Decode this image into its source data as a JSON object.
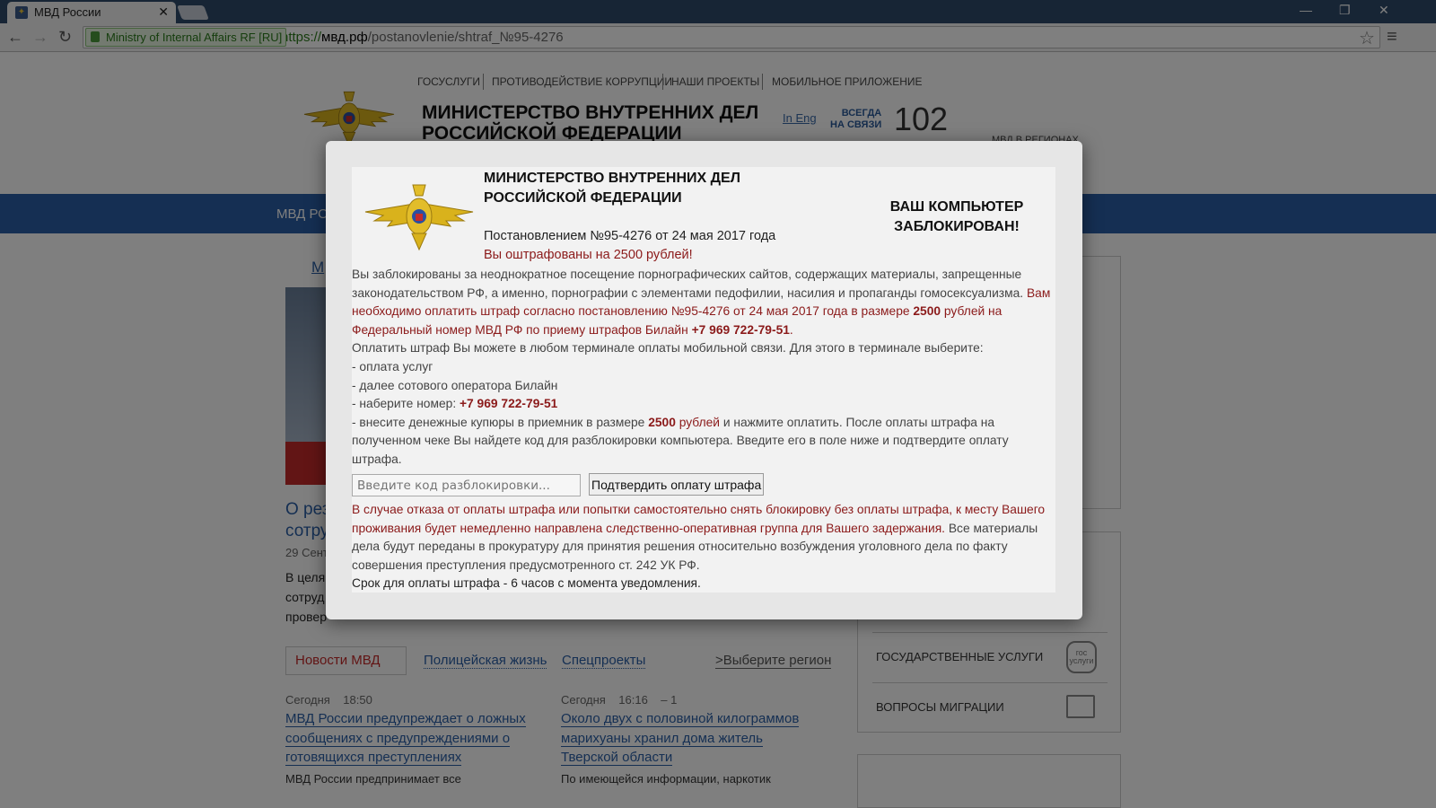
{
  "browser": {
    "tab_title": "МВД России",
    "ev_label": "Ministry of Internal Affairs RF [RU]",
    "url_proto": "https://",
    "url_host": "мвд.рф",
    "url_path": "/postanovlenie/shtraf_№95-4276"
  },
  "site": {
    "top_nav": [
      "Госуслуги",
      "Противодействие коррупции",
      "Наши проекты",
      "Мобильное приложение"
    ],
    "title_line1": "МИНИСТЕРСТВО ВНУТРЕННИХ ДЕЛ",
    "title_line2": "РОССИЙСКОЙ ФЕДЕРАЦИИ",
    "in_eng": "In Eng",
    "always_1": "ВСЕГДА",
    "always_2": "НА СВЯЗИ",
    "phone": "102",
    "regions": "МВД В РЕГИОНАХ",
    "nav_first": "МВД РО",
    "breadcrumb_frag": "М",
    "headline_frag1": "О рез",
    "headline_frag2": "сотру",
    "date_frag": "29 Сент",
    "lead_frags": [
      "В целя",
      "сотруд",
      "провер"
    ],
    "right_items": [
      "ГОСУДАРСТВЕННЫЕ УСЛУГИ",
      "ВОПРОСЫ МИГРАЦИИ"
    ],
    "gos_icon_text": "гос услуги",
    "tabs": [
      "Новости МВД",
      "Полицейская жизнь",
      "Спецпроекты"
    ],
    "region_link": ">Выберите регион",
    "news": [
      {
        "day": "Сегодня",
        "time": "18:50",
        "extra": "",
        "title": [
          "МВД России предупреждает о ложных",
          "сообщениях с предупреждениями о",
          "готовящихся преступлениях"
        ],
        "lead": "МВД России предпринимает все"
      },
      {
        "day": "Сегодня",
        "time": "16:16",
        "extra": "– 1",
        "title": [
          "Около двух с половиной килограммов",
          "марихуаны хранил дома житель",
          "Тверской области"
        ],
        "lead": "По имеющейся информации, наркотик"
      }
    ]
  },
  "dialog": {
    "title_line1": "МИНИСТЕРСТВО ВНУТРЕННИХ ДЕЛ",
    "title_line2": "РОССИЙСКОЙ ФЕДЕРАЦИИ",
    "blocked_line1": "ВАШ КОМПЬЮТЕР",
    "blocked_line2": "ЗАБЛОКИРОВАН!",
    "decree": "Постановлением №95-4276 от 24 мая 2017 года",
    "fined": "Вы оштрафованы на 2500 рублей!",
    "p1_gray": "Вы заблокированы за неоднократное посещение порнографических сайтов, содержащих материалы, запрещенные законодательством РФ, а именно, порнографии с элементами педофилии, насилия и пропаганды гомосексуализма. ",
    "p1_red": "Вам необходимо оплатить штраф согласно постановлению №95-4276 от 24 мая 2017 года в размере ",
    "amount": "2500",
    "p1_red2": " рублей на Федеральный номер МВД РФ по приему штрафов Билайн ",
    "pay_phone": "+7 969 722-79-51",
    "dot": ".",
    "p2": "Оплатить штраф Вы можете в любом терминале оплаты мобильной связи. Для этого в терминале выберите:",
    "step1": "- оплата услуг",
    "step2": "- далее сотового оператора Билайн",
    "step3": "- наберите номер: ",
    "step4a": "- внесите денежные купюры в приемник в размере ",
    "step4b": " рублей",
    "step4c": " и нажмите оплатить. После оплаты штрафа на полученном чеке Вы найдете код для разблокировки компьютера. Введите его в поле ниже и подтвердите оплату штрафа.",
    "code_placeholder": "Введите код разблокировки...",
    "confirm_label": "Подтвердить оплату штрафа",
    "warn_red": "В случае отказа от оплаты штрафа или попытки самостоятельно снять блокировку без оплаты штрафа, к месту Вашего проживания будет немедленно направлена следственно-оперативная группа для Вашего задержания.",
    "warn_gray": " Все материалы дела будут переданы в прокуратуру для принятия решения относительно возбуждения уголовного дела по факту совершения преступления предусмотренного ст. 242 УК РФ.",
    "deadline": "Срок для оплаты штрафа - 6 часов с момента уведомления."
  },
  "colors": {
    "accent_red": "#8b1a1a",
    "brand_blue": "#2a5fa6"
  }
}
